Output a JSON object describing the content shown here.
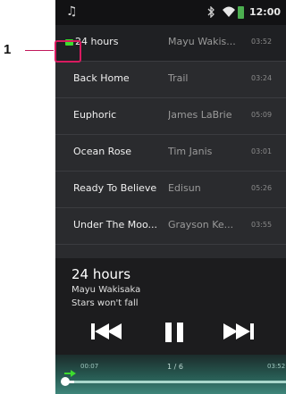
{
  "annotation": {
    "callout_number": "1"
  },
  "status_bar": {
    "music_icon": "music-note-icon",
    "bluetooth_icon": "bluetooth-icon",
    "wifi_icon": "wifi-icon",
    "battery_icon": "battery-icon",
    "time": "12:00"
  },
  "track_list": {
    "rows": [
      {
        "title": "24 hours",
        "artist": "Mayu Wakis...",
        "duration": "03:52",
        "playing": true
      },
      {
        "title": "Back Home",
        "artist": "Trail",
        "duration": "03:24"
      },
      {
        "title": "Euphoric",
        "artist": "James LaBrie",
        "duration": "05:09"
      },
      {
        "title": "Ocean Rose",
        "artist": "Tim Janis",
        "duration": "03:01"
      },
      {
        "title": "Ready To Believe",
        "artist": "Edisun",
        "duration": "05:26"
      },
      {
        "title": "Under The Moo...",
        "artist": "Grayson Ke...",
        "duration": "03:55"
      }
    ]
  },
  "now_playing": {
    "title": "24 hours",
    "artist": "Mayu Wakisaka",
    "album": "Stars won't fall",
    "elapsed": "00:07",
    "track_position": "1 / 6",
    "total": "03:52",
    "progress_fraction": 0.03
  },
  "controls": {
    "prev_icon": "skip-previous-icon",
    "pause_icon": "pause-icon",
    "next_icon": "skip-next-icon"
  },
  "colors": {
    "playing_indicator": "#3ddc2e",
    "callout": "#d81b60",
    "progress_bg": "#275a52"
  }
}
